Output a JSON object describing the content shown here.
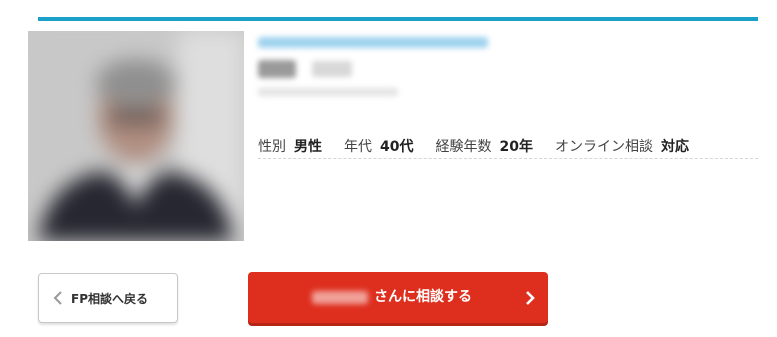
{
  "profile": {
    "stats": [
      {
        "label": "性別",
        "value": "男性"
      },
      {
        "label": "年代",
        "value": "40代"
      },
      {
        "label": "経験年数",
        "value": "20年"
      },
      {
        "label": "オンライン相談",
        "value": "対応"
      }
    ]
  },
  "actions": {
    "back_label": "FP相談へ戻る",
    "consult_label": "さんに相談する"
  },
  "icons": {
    "back": "chevron-left-icon",
    "consult": "chevron-right-icon"
  },
  "colors": {
    "accent_bar": "#1aa0c9",
    "consult_button": "#de2f1e"
  }
}
